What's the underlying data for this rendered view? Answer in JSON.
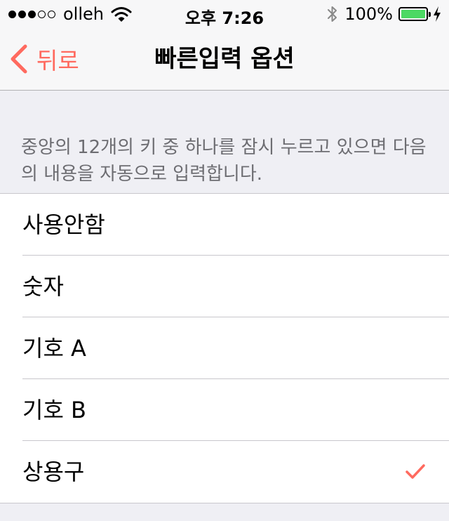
{
  "status_bar": {
    "carrier": "olleh",
    "time": "오후 7:26",
    "battery_percent": "100%",
    "battery_level": 1.0,
    "signal_bars_filled": 3,
    "signal_bars_total": 5
  },
  "nav": {
    "back_label": "뒤로",
    "title": "빠른입력 옵션"
  },
  "description": "중앙의 12개의 키 중 하나를 잠시 누르고 있으면 다음의 내용을 자동으로 입력합니다.",
  "options": [
    {
      "label": "사용안함",
      "selected": false
    },
    {
      "label": "숫자",
      "selected": false
    },
    {
      "label": "기호 A",
      "selected": false
    },
    {
      "label": "기호 B",
      "selected": false
    },
    {
      "label": "상용구",
      "selected": true
    }
  ],
  "colors": {
    "accent": "#ff6a5f",
    "battery": "#4cd964"
  }
}
